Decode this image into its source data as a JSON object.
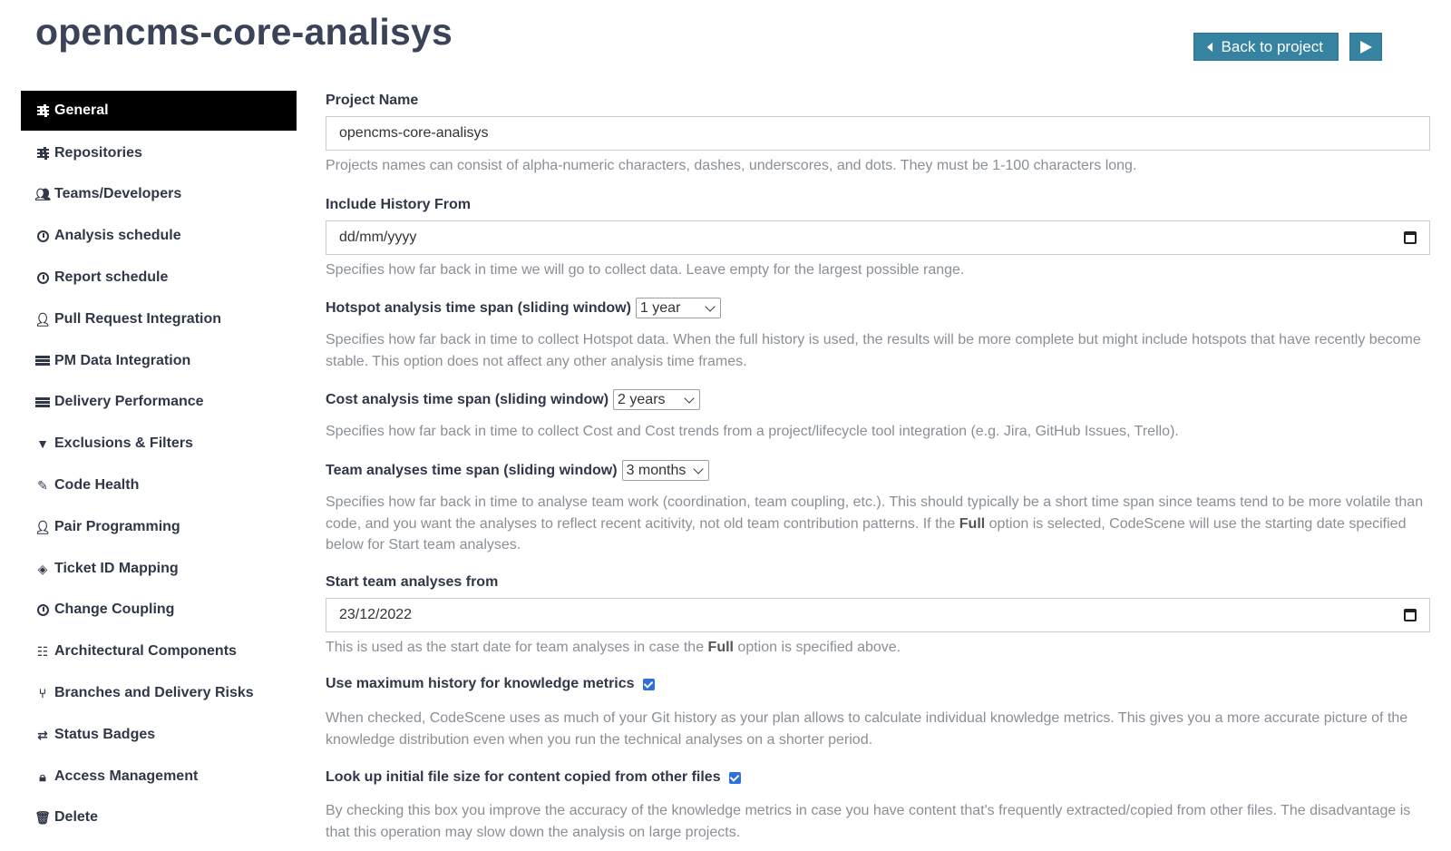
{
  "header": {
    "title": "opencms-core-analisys",
    "back_label": "Back to project"
  },
  "sidebar": {
    "items": [
      {
        "label": "General",
        "icon": "sliders-icon"
      },
      {
        "label": "Repositories",
        "icon": "sliders-icon"
      },
      {
        "label": "Teams/Developers",
        "icon": "users-icon"
      },
      {
        "label": "Analysis schedule",
        "icon": "clock-icon"
      },
      {
        "label": "Report schedule",
        "icon": "clock-icon"
      },
      {
        "label": "Pull Request Integration",
        "icon": "user-icon"
      },
      {
        "label": "PM Data Integration",
        "icon": "server-icon"
      },
      {
        "label": "Delivery Performance",
        "icon": "server-icon"
      },
      {
        "label": "Exclusions & Filters",
        "icon": "filter-icon"
      },
      {
        "label": "Code Health",
        "icon": "pen-icon"
      },
      {
        "label": "Pair Programming",
        "icon": "user-plus-icon"
      },
      {
        "label": "Ticket ID Mapping",
        "icon": "tag-icon"
      },
      {
        "label": "Change Coupling",
        "icon": "clock-icon"
      },
      {
        "label": "Architectural Components",
        "icon": "sitemap-icon"
      },
      {
        "label": "Branches and Delivery Risks",
        "icon": "branch-icon"
      },
      {
        "label": "Status Badges",
        "icon": "exchange-icon"
      },
      {
        "label": "Access Management",
        "icon": "lock-icon"
      },
      {
        "label": "Delete",
        "icon": "trash-icon"
      }
    ]
  },
  "form": {
    "project_name": {
      "label": "Project Name",
      "value": "opencms-core-analisys",
      "help": "Projects names can consist of alpha-numeric characters, dashes, underscores, and dots. They must be 1-100 characters long."
    },
    "include_history": {
      "label": "Include History From",
      "value": "dd/mm/yyyy",
      "help": "Specifies how far back in time we will go to collect data. Leave empty for the largest possible range."
    },
    "hotspot_span": {
      "label": "Hotspot analysis time span (sliding window)",
      "value": "1 year",
      "help": "Specifies how far back in time to collect Hotspot data. When the full history is used, the results will be more complete but might include hotspots that have recently become stable. This option does not affect any other analysis time frames."
    },
    "cost_span": {
      "label": "Cost analysis time span (sliding window)",
      "value": "2 years",
      "help": "Specifies how far back in time to collect Cost and Cost trends from a project/lifecycle tool integration (e.g. Jira, GitHub Issues, Trello)."
    },
    "team_span": {
      "label": "Team analyses time span (sliding window)",
      "value": "3 months",
      "help_pre": "Specifies how far back in time to analyse team work (coordination, team coupling, etc.). This should typically be a short time span since teams tend to be more volatile than code, and you want the analyses to reflect recent acitivity, not old team contribution patterns. If the ",
      "help_bold": "Full",
      "help_post": " option is selected, CodeScene will use the starting date specified below for Start team analyses."
    },
    "start_team": {
      "label": "Start team analyses from",
      "value": "23/12/2022",
      "help_pre": "This is used as the start date for team analyses in case the ",
      "help_bold": "Full",
      "help_post": " option is specified above."
    },
    "max_history": {
      "label": "Use maximum history for knowledge metrics",
      "checked": true,
      "help": "When checked, CodeScene uses as much of your Git history as your plan allows to calculate individual knowledge metrics. This gives you a more accurate picture of the knowledge distribution even when you run the technical analyses on a shorter period."
    },
    "initial_size": {
      "label": "Look up initial file size for content copied from other files",
      "checked": true,
      "help": "By checking this box you improve the accuracy of the knowledge metrics in case you have content that's frequently extracted/copied from other files. The disadvantage is that this operation may slow down the analysis on large projects."
    }
  },
  "colors": {
    "accent": "#3583a0",
    "active_nav_bg": "#000000",
    "text": "#2f3748",
    "help_text": "#8a8f96"
  }
}
